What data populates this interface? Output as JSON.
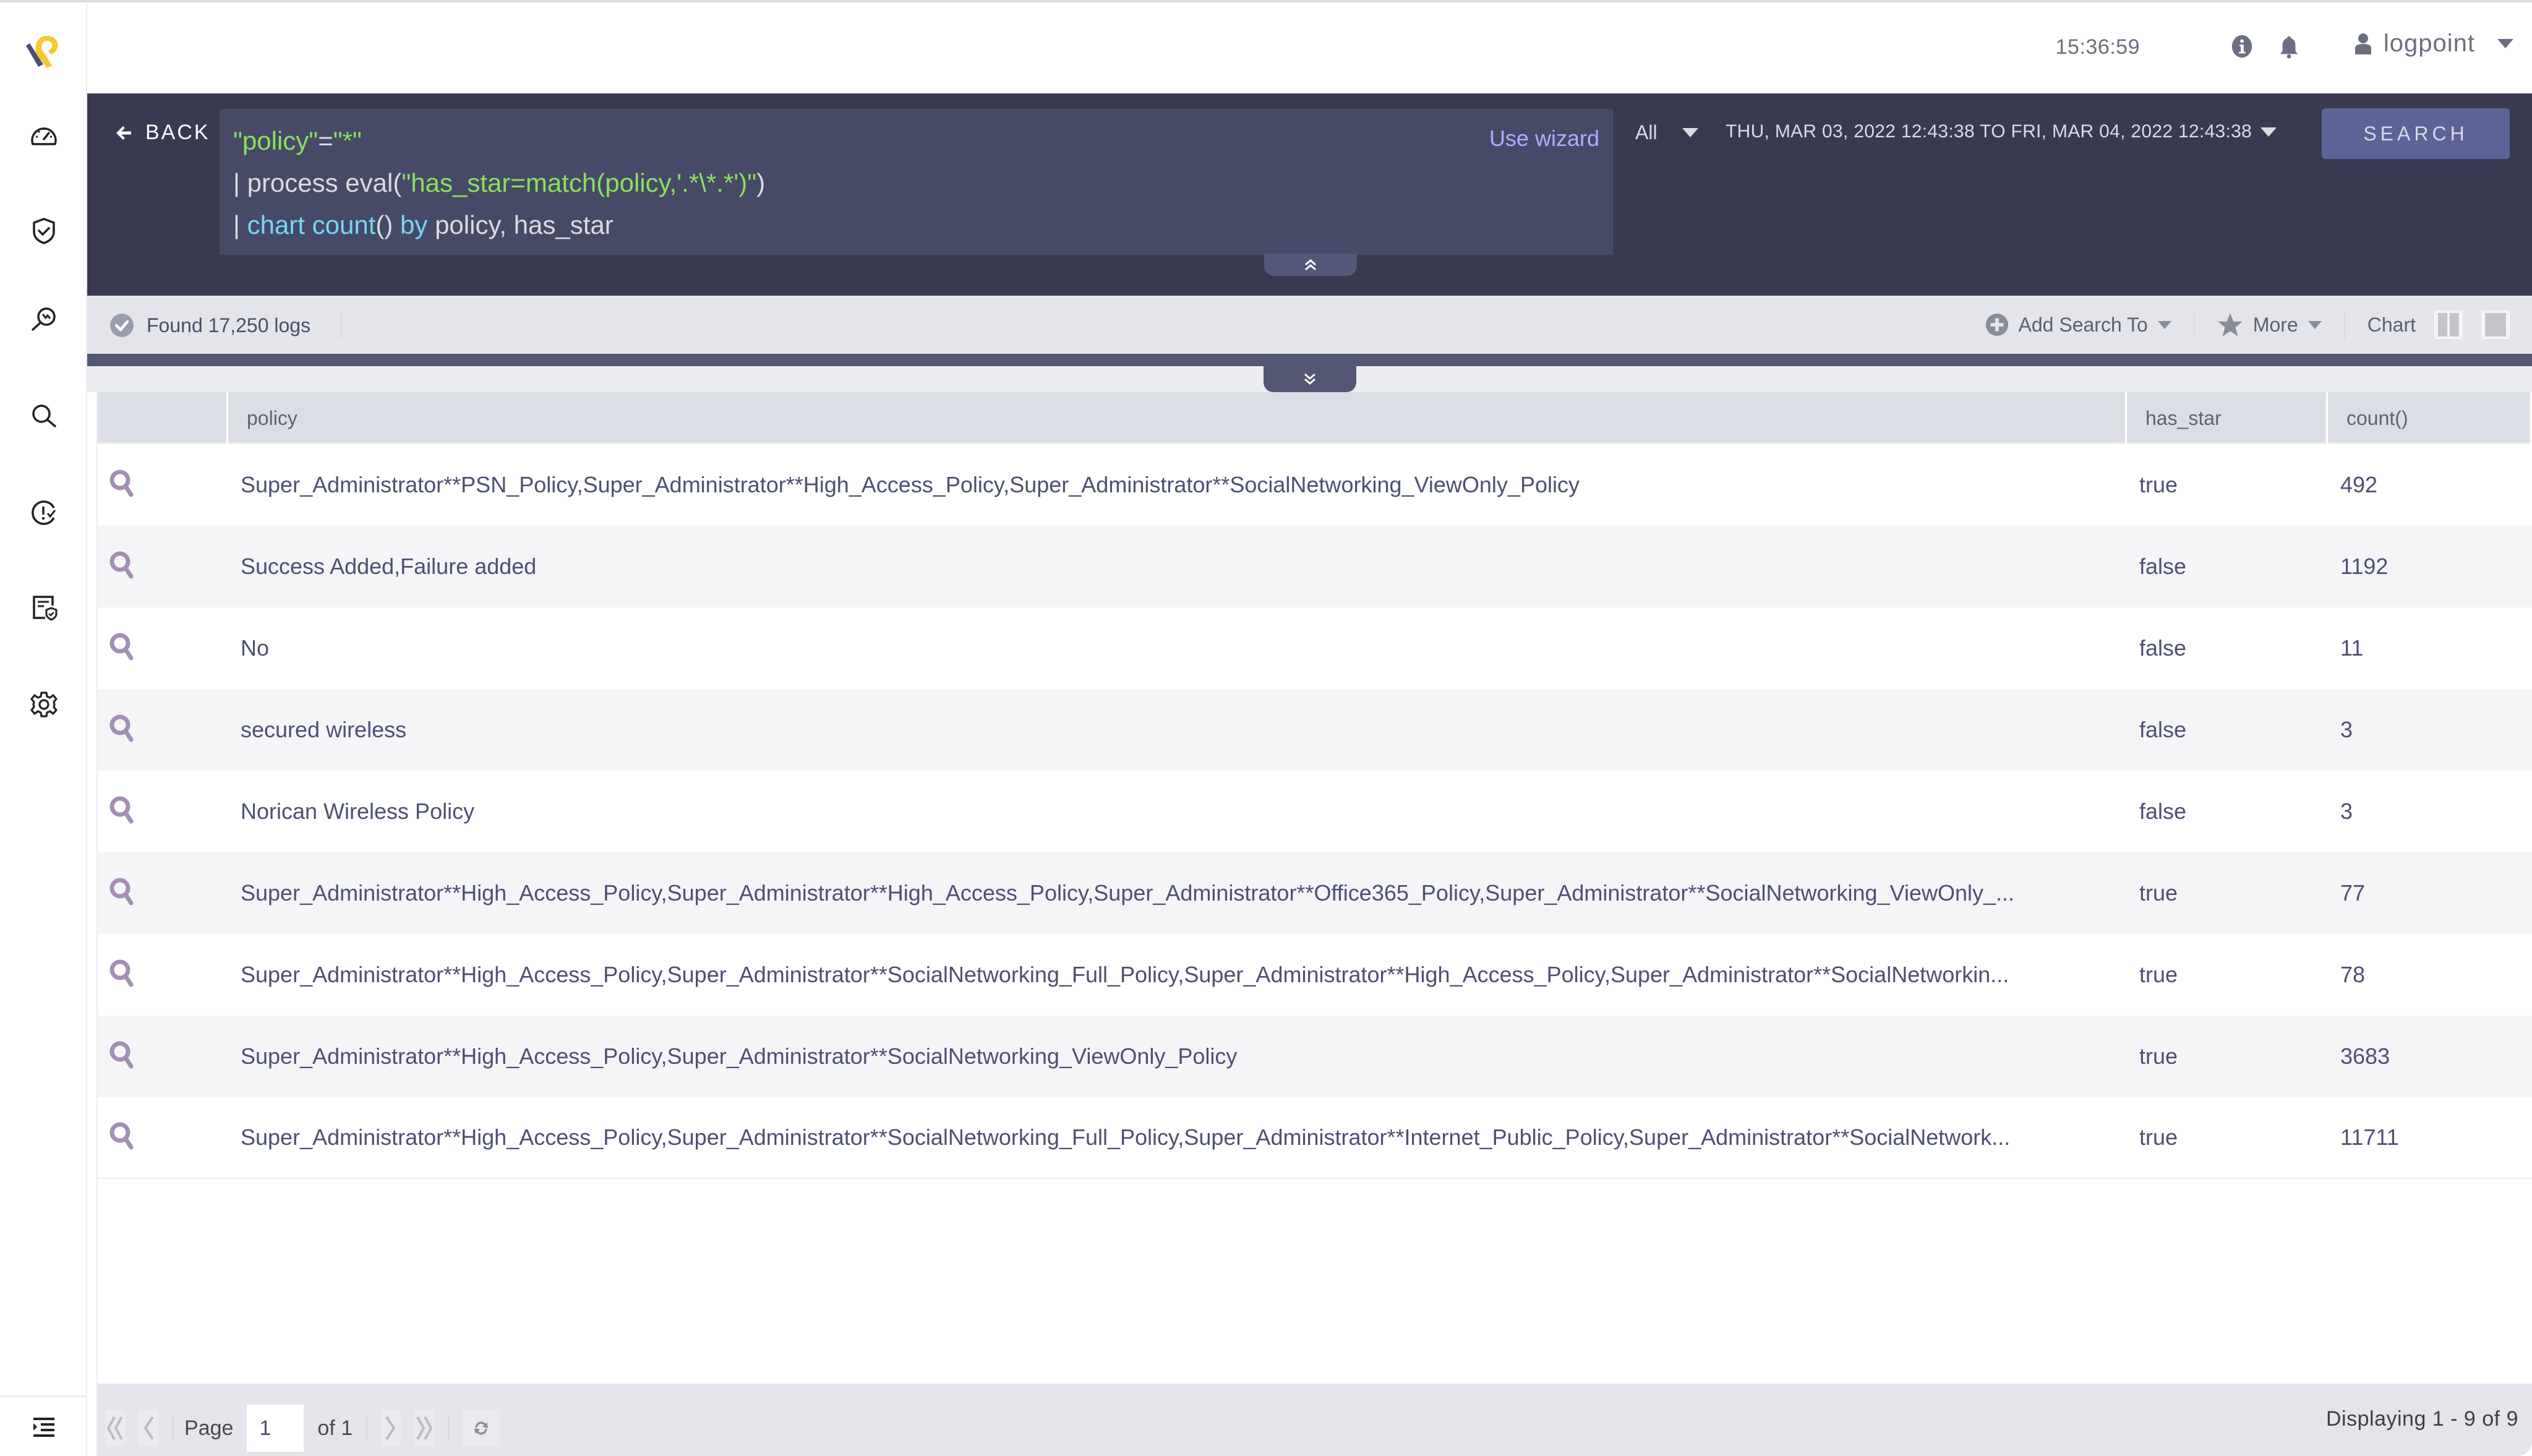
{
  "app": {
    "brand_colors": {
      "logo_yellow": "#f6c92d",
      "logo_slate": "#4c4f70",
      "accent": "#5d6395",
      "query_bg": "#393a52"
    }
  },
  "sidebar": {
    "items": [
      {
        "name": "dashboard",
        "icon": "speedometer-icon"
      },
      {
        "name": "security",
        "icon": "shield-check-icon"
      },
      {
        "name": "investigate",
        "icon": "search-pulse-icon"
      },
      {
        "name": "search",
        "icon": "search-icon"
      },
      {
        "name": "incidents",
        "icon": "alert-clock-icon"
      },
      {
        "name": "reports",
        "icon": "report-shield-icon"
      },
      {
        "name": "settings",
        "icon": "gear-icon"
      }
    ],
    "bottom_icon": "collapse-menu-icon"
  },
  "header": {
    "clock": "15:36:59",
    "info_icon": "info-icon",
    "notifications_icon": "bell-icon",
    "user": "logpoint"
  },
  "query": {
    "back_label": "BACK",
    "lines": [
      [
        {
          "text": "\"policy\"",
          "color": "green"
        },
        {
          "text": "=",
          "color": "white"
        },
        {
          "text": "\"*\"",
          "color": "green"
        }
      ],
      [
        {
          "text": "| process eval(",
          "color": "white"
        },
        {
          "text": "\"has_star=match(policy,'.*\\*.*')\"",
          "color": "green"
        },
        {
          "text": ")",
          "color": "white"
        }
      ],
      [
        {
          "text": "| ",
          "color": "white"
        },
        {
          "text": "chart count",
          "color": "cyan"
        },
        {
          "text": "() ",
          "color": "white"
        },
        {
          "text": "by",
          "color": "cyan"
        },
        {
          "text": " policy, has_star",
          "color": "white"
        }
      ]
    ],
    "wizard_label": "Use wizard",
    "repo_selected": "All",
    "time_range": "THU, MAR 03, 2022 12:43:38 TO FRI, MAR 04, 2022 12:43:38",
    "search_label": "SEARCH"
  },
  "toolbar": {
    "found_text": "Found 17,250 logs",
    "add_search_label": "Add Search To",
    "more_label": "More",
    "chart_label": "Chart"
  },
  "table": {
    "columns": [
      "",
      "policy",
      "has_star",
      "count()"
    ],
    "rows": [
      {
        "policy": "Super_Administrator**PSN_Policy,Super_Administrator**High_Access_Policy,Super_Administrator**SocialNetworking_ViewOnly_Policy",
        "has_star": "true",
        "count": "492"
      },
      {
        "policy": "Success Added,Failure added",
        "has_star": "false",
        "count": "1192"
      },
      {
        "policy": "No",
        "has_star": "false",
        "count": "11"
      },
      {
        "policy": "secured wireless",
        "has_star": "false",
        "count": "3"
      },
      {
        "policy": "Norican Wireless Policy",
        "has_star": "false",
        "count": "3"
      },
      {
        "policy": "Super_Administrator**High_Access_Policy,Super_Administrator**High_Access_Policy,Super_Administrator**Office365_Policy,Super_Administrator**SocialNetworking_ViewOnly_...",
        "has_star": "true",
        "count": "77"
      },
      {
        "policy": "Super_Administrator**High_Access_Policy,Super_Administrator**SocialNetworking_Full_Policy,Super_Administrator**High_Access_Policy,Super_Administrator**SocialNetworkin...",
        "has_star": "true",
        "count": "78"
      },
      {
        "policy": "Super_Administrator**High_Access_Policy,Super_Administrator**SocialNetworking_ViewOnly_Policy",
        "has_star": "true",
        "count": "3683"
      },
      {
        "policy": "Super_Administrator**High_Access_Policy,Super_Administrator**SocialNetworking_Full_Policy,Super_Administrator**Internet_Public_Policy,Super_Administrator**SocialNetwork...",
        "has_star": "true",
        "count": "11711"
      }
    ]
  },
  "pagination": {
    "page_label": "Page",
    "page_value": "1",
    "of_label": "of 1",
    "displaying": "Displaying 1 - 9 of 9"
  }
}
